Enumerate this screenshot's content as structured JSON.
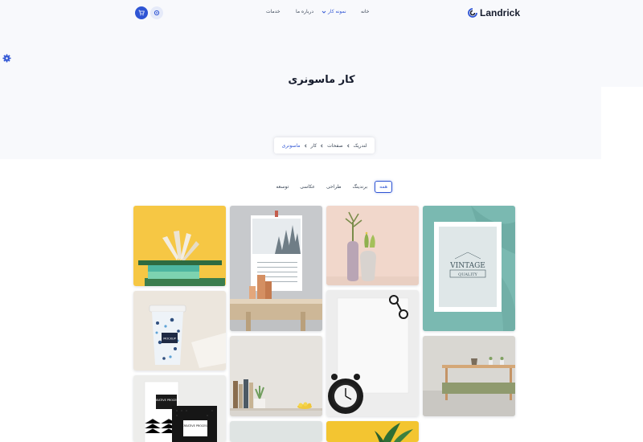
{
  "brand": {
    "name": "Landrick"
  },
  "nav": {
    "home": "خانه",
    "portfolio": "نمونه کار",
    "about": "درباره ما",
    "services": "خدمات"
  },
  "page": {
    "title": "کار ماسونری"
  },
  "breadcrumb": {
    "items": [
      "لندریک",
      "صفحات",
      "کار"
    ],
    "current": "ماسونری"
  },
  "filters": {
    "all": "همه",
    "branding": "برندینگ",
    "design": "طراحی",
    "photography": "عکاسی",
    "development": "توسعه"
  },
  "gallery": {
    "mockup_cup_label": "MOCKUP",
    "book_label_1": "CREATIVE PROCESS",
    "book_label_2": "CREATIVE PROCESS",
    "poster_line1": "VINTAGE",
    "poster_line2": "QUALITY"
  },
  "colors": {
    "primary": "#2f55d4",
    "hero_bg": "#f8f9fc",
    "text": "#161c2d",
    "muted": "#3c4858"
  },
  "icons": [
    "logo-icon",
    "cart-icon",
    "gear-icon",
    "chevron-down-icon",
    "chevron-left-icon"
  ]
}
